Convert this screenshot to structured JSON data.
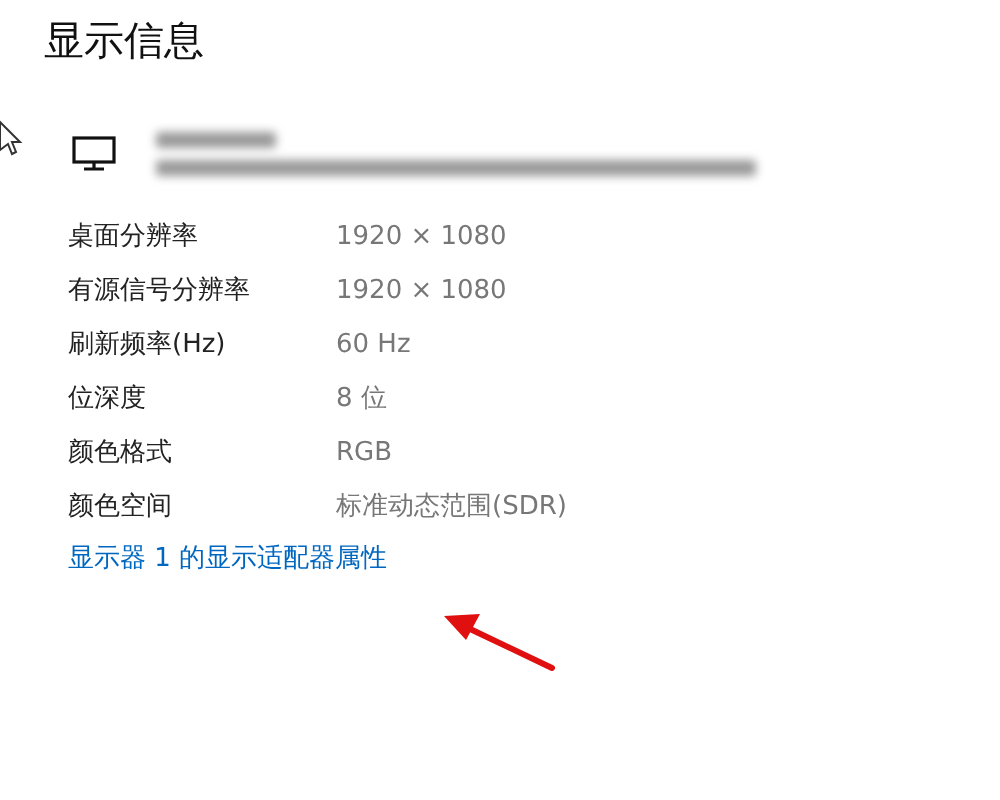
{
  "title": "显示信息",
  "properties": [
    {
      "label": "桌面分辨率",
      "value": "1920 × 1080"
    },
    {
      "label": "有源信号分辨率",
      "value": "1920 × 1080"
    },
    {
      "label": "刷新频率(Hz)",
      "value": "60 Hz"
    },
    {
      "label": "位深度",
      "value": "8 位"
    },
    {
      "label": "颜色格式",
      "value": "RGB"
    },
    {
      "label": "颜色空间",
      "value": "标准动态范围(SDR)"
    }
  ],
  "adapter_link": "显示器 1 的显示适配器属性"
}
